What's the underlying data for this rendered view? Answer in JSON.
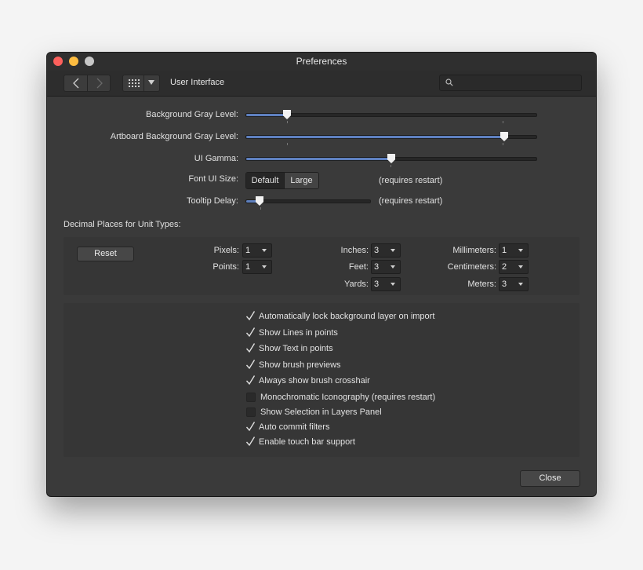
{
  "window": {
    "title": "Preferences"
  },
  "toolbar": {
    "section": "User Interface",
    "search_placeholder": ""
  },
  "sliders": [
    {
      "label": "Background Gray Level:",
      "value": 0.14
    },
    {
      "label": "Artboard Background Gray Level:",
      "value": 0.89
    },
    {
      "label": "UI Gamma:",
      "value": 0.5
    }
  ],
  "font_ui_size": {
    "label": "Font UI Size:",
    "options": [
      "Default",
      "Large"
    ],
    "selected": "Default",
    "note": "(requires restart)"
  },
  "tooltip_delay": {
    "label": "Tooltip Delay:",
    "value": 0.11,
    "note": "(requires restart)"
  },
  "decimal": {
    "title": "Decimal Places for Unit Types:",
    "reset_label": "Reset",
    "units": [
      {
        "label": "Pixels:",
        "value": "1"
      },
      {
        "label": "Points:",
        "value": "1"
      },
      {
        "label": "Inches:",
        "value": "3"
      },
      {
        "label": "Feet:",
        "value": "3"
      },
      {
        "label": "Yards:",
        "value": "3"
      },
      {
        "label": "Millimeters:",
        "value": "1"
      },
      {
        "label": "Centimeters:",
        "value": "2"
      },
      {
        "label": "Meters:",
        "value": "3"
      }
    ]
  },
  "options": [
    {
      "label": "Automatically lock background layer on import",
      "checked": true
    },
    {
      "label": "Show Lines in points",
      "checked": true
    },
    {
      "label": "Show Text in points",
      "checked": true
    },
    {
      "label": "Show brush previews",
      "checked": true
    },
    {
      "label": "Always show brush crosshair",
      "checked": true
    },
    {
      "label": "Monochromatic Iconography (requires restart)",
      "checked": false
    },
    {
      "label": "Show Selection in Layers Panel",
      "checked": false
    },
    {
      "label": "Auto commit filters",
      "checked": true
    },
    {
      "label": "Enable touch bar support",
      "checked": true
    }
  ],
  "close_label": "Close",
  "colors": {
    "accent": "#5e80bf",
    "window_bg": "#3a3a3a",
    "panel_bg": "#363636"
  }
}
